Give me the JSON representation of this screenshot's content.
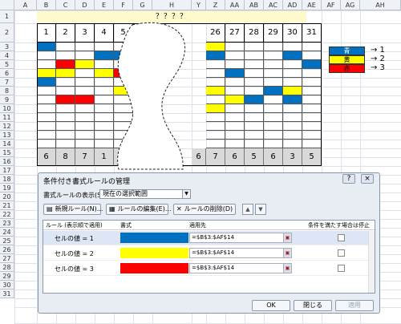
{
  "column_headers": [
    "A",
    "B",
    "C",
    "D",
    "E",
    "F",
    "G",
    "H",
    "Y",
    "Z",
    "AA",
    "AB",
    "AC",
    "AD",
    "AE",
    "AF",
    "AG",
    "AH",
    "AI"
  ],
  "row_headers": [
    "1",
    "2",
    "3",
    "4",
    "5",
    "6",
    "7",
    "8",
    "9",
    "10",
    "11",
    "12",
    "13",
    "14",
    "15",
    "16",
    "17",
    "18",
    "19",
    "20",
    "21",
    "22",
    "23",
    "24",
    "25",
    "26",
    "27",
    "28",
    "29",
    "30",
    "31"
  ],
  "title": "？？？？",
  "day_headers_left": [
    "1",
    "2",
    "3",
    "4",
    "5"
  ],
  "day_headers_right": [
    "26",
    "27",
    "28",
    "29",
    "30",
    "31"
  ],
  "bottom_counts_left": [
    "6",
    "8",
    "7",
    "1",
    "4"
  ],
  "bottom_counts_right": [
    "6",
    "7",
    "6",
    "5",
    "6",
    "3",
    "5"
  ],
  "colors": {
    "blue": "#0070c0",
    "yellow": "#ffff00",
    "red": "#ff0000",
    "title_band": "#fffacc"
  },
  "legend": [
    {
      "label": "青",
      "arrow": "→ 1",
      "color": "#0070c0"
    },
    {
      "label": "黄",
      "arrow": "→ 2",
      "color": "#ffff00"
    },
    {
      "label": "赤",
      "arrow": "→ 3",
      "color": "#ff0000"
    }
  ],
  "dialog": {
    "title": "条件付き書式ルールの管理",
    "help": "?",
    "close": "×",
    "show_rules_label": "書式ルールの表示(S):",
    "show_rules_value": "現在の選択範囲",
    "new_rule": "新規ルール(N)...",
    "edit_rule": "ルールの編集(E)...",
    "delete_rule": "ルールの削除(D)",
    "col_rule": "ルール (表示順で適用)",
    "col_format": "書式",
    "col_applies": "適用先",
    "col_stop": "条件を満たす場合は停止",
    "rules": [
      {
        "label": "セルの値 = 1",
        "color": "#0070c0",
        "applies_to": "=$B$3:$AF$14"
      },
      {
        "label": "セルの値 = 2",
        "color": "#ffff00",
        "applies_to": "=$B$3:$AF$14"
      },
      {
        "label": "セルの値 = 3",
        "color": "#ff0000",
        "applies_to": "=$B$3:$AF$14"
      }
    ],
    "ok": "OK",
    "close_btn": "閉じる",
    "apply": "適用"
  }
}
